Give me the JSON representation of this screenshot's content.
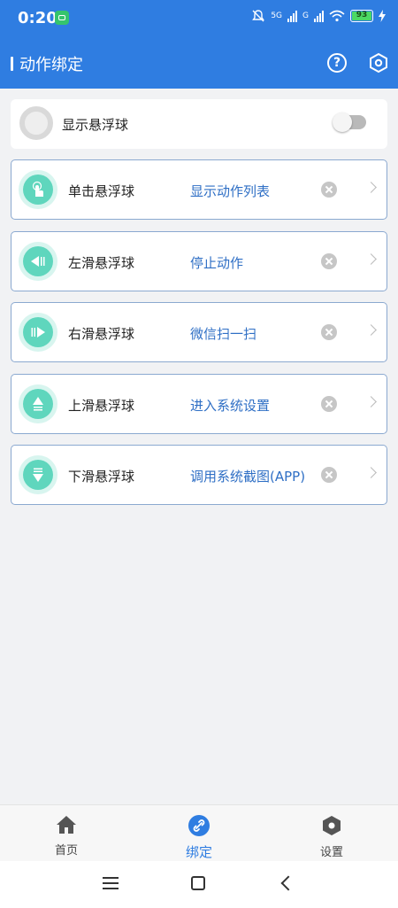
{
  "status_bar": {
    "time": "0:20",
    "network_1": "5G",
    "network_2": "G",
    "battery": "93"
  },
  "app_bar": {
    "title": "动作绑定",
    "help_label": "?",
    "accent": "#2f7de1"
  },
  "float_toggle": {
    "label": "显示悬浮球",
    "enabled": false
  },
  "bindings": [
    {
      "gesture": "单击悬浮球",
      "action": "显示动作列表",
      "icon": "tap-icon"
    },
    {
      "gesture": "左滑悬浮球",
      "action": "停止动作",
      "icon": "swipe-left-icon"
    },
    {
      "gesture": "右滑悬浮球",
      "action": "微信扫一扫",
      "icon": "swipe-right-icon"
    },
    {
      "gesture": "上滑悬浮球",
      "action": "进入系统设置",
      "icon": "swipe-up-icon"
    },
    {
      "gesture": "下滑悬浮球",
      "action": "调用系统截图(APP)",
      "icon": "swipe-down-icon"
    }
  ],
  "bottom_nav": {
    "home": "首页",
    "bind": "绑定",
    "settings": "设置",
    "active": "bind"
  },
  "colors": {
    "icon_teal": "#5fd6bd",
    "action_blue": "#2f6fc5"
  }
}
